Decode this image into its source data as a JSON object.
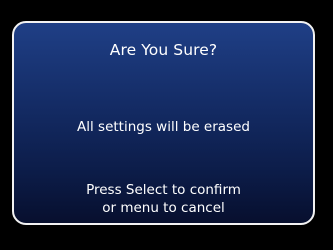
{
  "dialog": {
    "title": "Are You Sure?",
    "message": "All settings will be erased",
    "instructions": [
      "Press Select to confirm",
      "or menu to cancel"
    ]
  },
  "colors": {
    "border": "#f2f2f2",
    "gradient_top": "#1f3f86",
    "gradient_bottom": "#070f2e",
    "text": "#ffffff",
    "background": "#000000"
  }
}
